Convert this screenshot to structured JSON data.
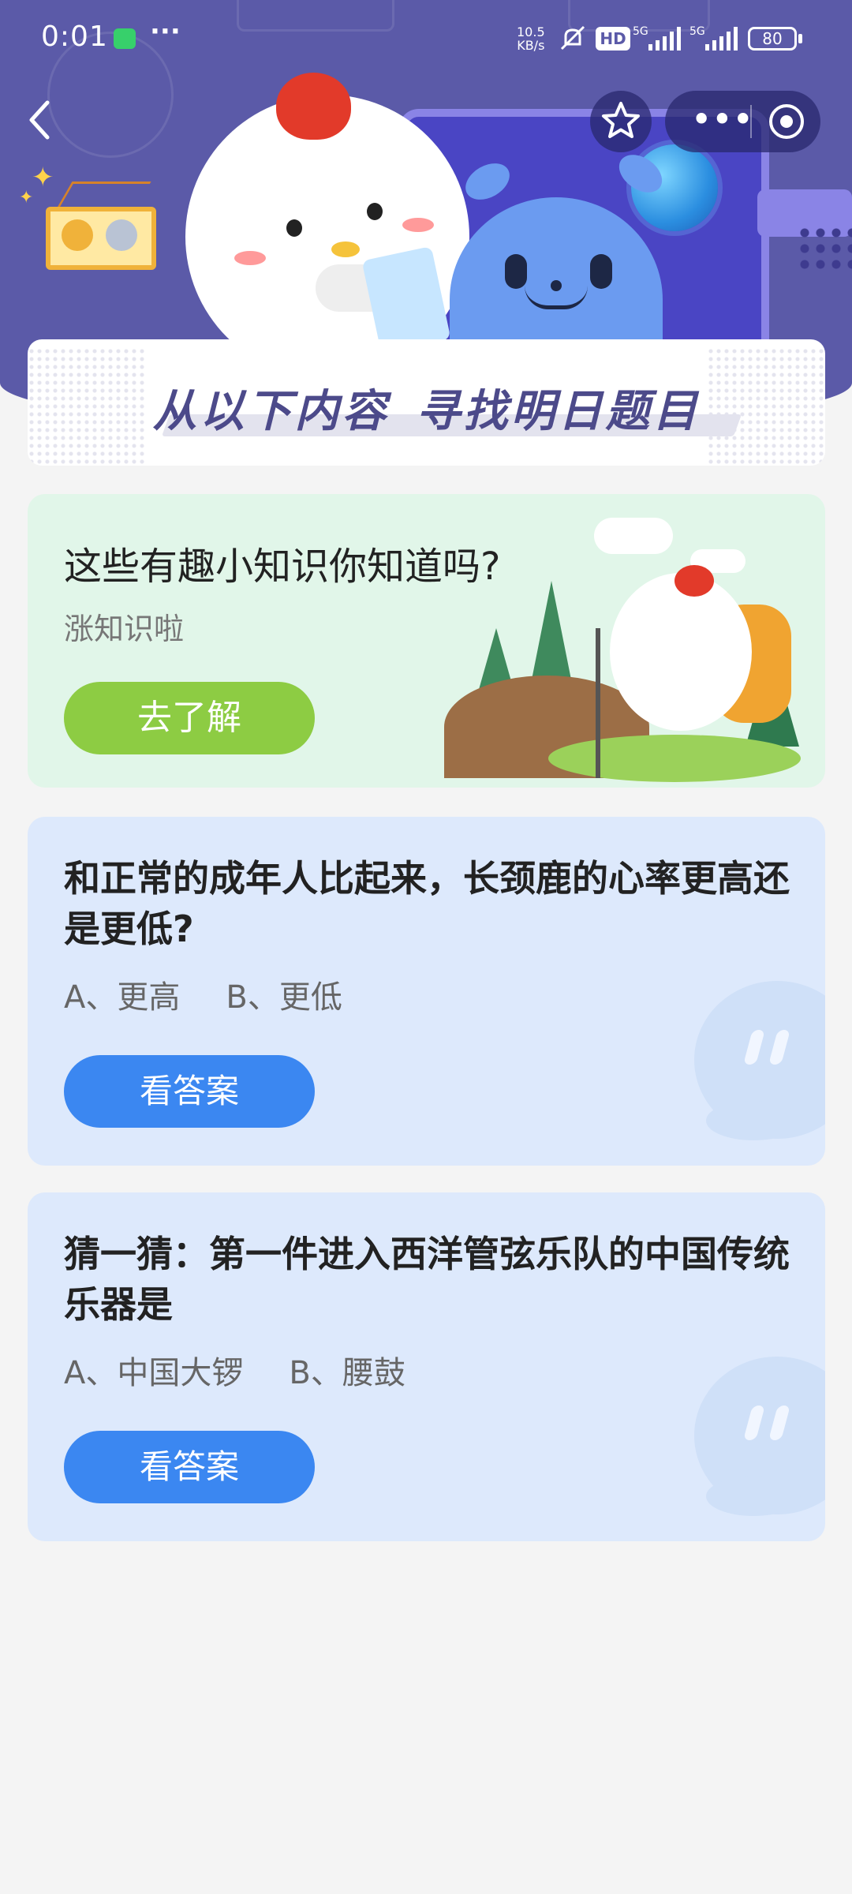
{
  "status_bar": {
    "time": "0:01",
    "more": "···",
    "net_speed_value": "10.5",
    "net_speed_unit": "KB/s",
    "hd": "HD",
    "sig1": "5G",
    "sig2": "5G",
    "battery": "80"
  },
  "header": {
    "title_part1": "从以下内容",
    "title_part2": "寻找明日题目"
  },
  "knowledge_card": {
    "title": "这些有趣小知识你知道吗?",
    "subtitle": "涨知识啦",
    "button": "去了解"
  },
  "questions": [
    {
      "text": "和正常的成年人比起来，长颈鹿的心率更高还是更低?",
      "option_a": "A、更高",
      "option_b": "B、更低",
      "button": "看答案"
    },
    {
      "text": "猜一猜：第一件进入西洋管弦乐队的中国传统乐器是",
      "option_a": "A、中国大锣",
      "option_b": "B、腰鼓",
      "button": "看答案"
    }
  ],
  "colors": {
    "banner": "#5b5aa8",
    "green_button": "#8dcc43",
    "blue_button": "#3b87f1",
    "knowledge_bg": "#e1f6e9",
    "question_bg": "#dde9fc"
  },
  "icons": [
    "back-icon",
    "star-icon",
    "more-icon",
    "target-icon",
    "wechat-icon",
    "mute-icon"
  ]
}
